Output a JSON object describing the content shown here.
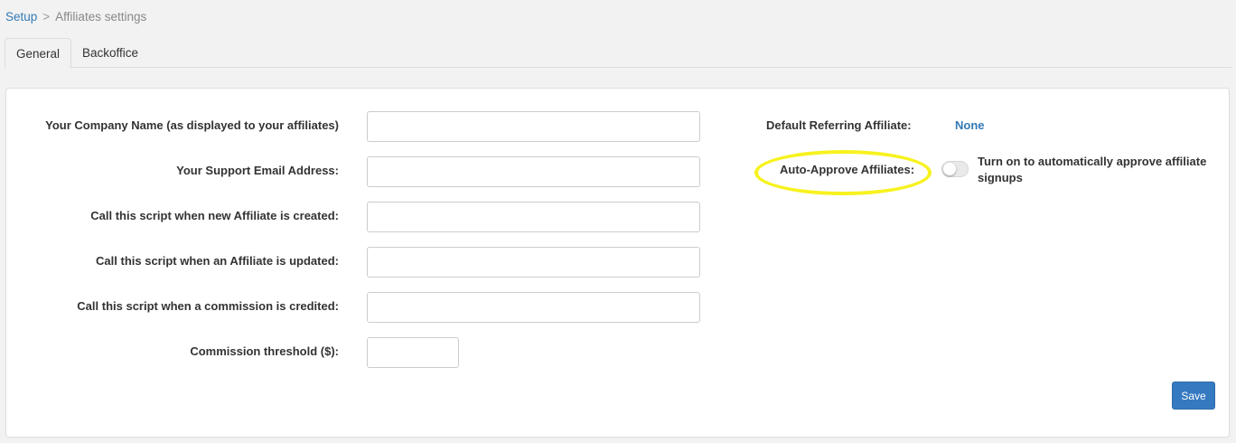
{
  "breadcrumb": {
    "root": "Setup",
    "separator": ">",
    "current": "Affiliates settings"
  },
  "tabs": [
    {
      "label": "General",
      "active": true
    },
    {
      "label": "Backoffice",
      "active": false
    }
  ],
  "form": {
    "company_name": {
      "label": "Your Company Name (as displayed to your affiliates)",
      "value": ""
    },
    "support_email": {
      "label": "Your Support Email Address:",
      "value": ""
    },
    "script_created": {
      "label": "Call this script when new Affiliate is created:",
      "value": ""
    },
    "script_updated": {
      "label": "Call this script when an Affiliate is updated:",
      "value": ""
    },
    "script_commission": {
      "label": "Call this script when a commission is credited:",
      "value": ""
    },
    "commission_threshold": {
      "label": "Commission threshold ($):",
      "value": ""
    }
  },
  "settings": {
    "default_referrer_label": "Default Referring Affiliate:",
    "default_referrer_value": "None",
    "auto_approve_label": "Auto-Approve Affiliates:",
    "auto_approve_on": false,
    "auto_approve_description": "Turn on to automatically approve affiliate signups",
    "highlight_color": "#f7f21e"
  },
  "actions": {
    "save_label": "Save"
  },
  "colors": {
    "link": "#337ab7",
    "primary_button": "#3579c1",
    "background": "#f2f2f2"
  }
}
